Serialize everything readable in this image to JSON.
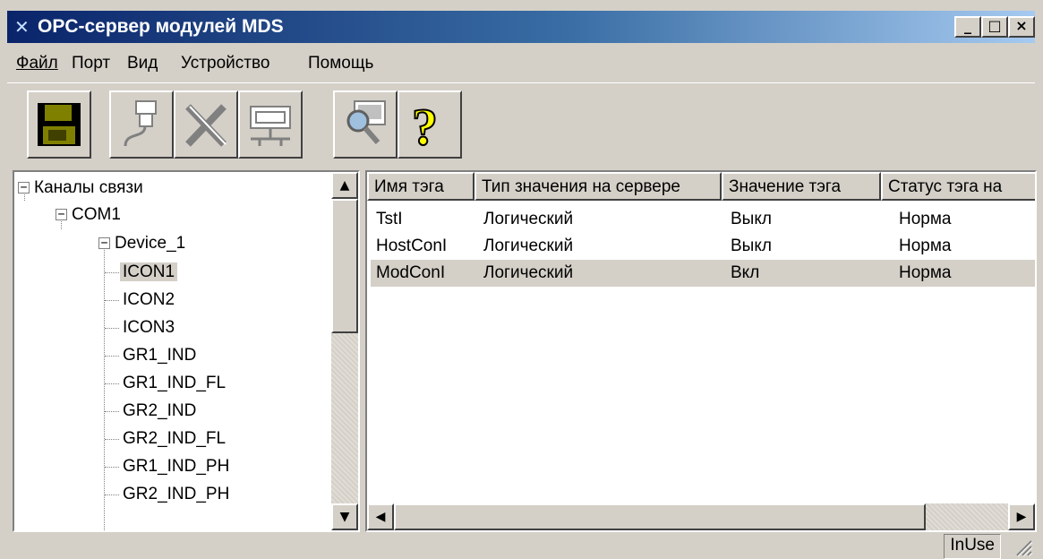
{
  "window": {
    "title": "OPC-сервер модулей MDS",
    "controls": {
      "minimize": "_",
      "maximize": "□",
      "close": "×"
    }
  },
  "menu": {
    "items": [
      {
        "label": "Файл"
      },
      {
        "label": "Порт"
      },
      {
        "label": "Вид"
      },
      {
        "label": "Устройство"
      },
      {
        "label": "Помощь"
      }
    ]
  },
  "toolbar": {
    "buttons": [
      {
        "icon": "save-icon"
      },
      {
        "icon": "connect-port-icon"
      },
      {
        "icon": "delete-icon"
      },
      {
        "icon": "device-icon"
      },
      {
        "icon": "monitor-search-icon"
      },
      {
        "icon": "help-icon"
      }
    ]
  },
  "tree": {
    "root": "Каналы связи",
    "port": "COM1",
    "device": "Device_1",
    "tags": [
      "ICON1",
      "ICON2",
      "ICON3",
      "GR1_IND",
      "GR1_IND_FL",
      "GR2_IND",
      "GR2_IND_FL",
      "GR1_IND_PH",
      "GR2_IND_PH"
    ],
    "selected": "ICON1"
  },
  "list": {
    "columns": [
      "Имя тэга",
      "Тип значения на сервере",
      "Значение тэга",
      "Статус тэга на"
    ],
    "rows": [
      {
        "name": "TstI",
        "type": "Логический",
        "value": "Выкл",
        "status": "Норма"
      },
      {
        "name": "HostConI",
        "type": "Логический",
        "value": "Выкл",
        "status": "Норма"
      },
      {
        "name": "ModConI",
        "type": "Логический",
        "value": "Вкл",
        "status": "Норма"
      }
    ],
    "selected_row": 2
  },
  "statusbar": {
    "text": "InUse"
  },
  "colors": {
    "titlebar_start": "#0a246a",
    "titlebar_end": "#a6caf0",
    "face": "#d4d0c8"
  }
}
